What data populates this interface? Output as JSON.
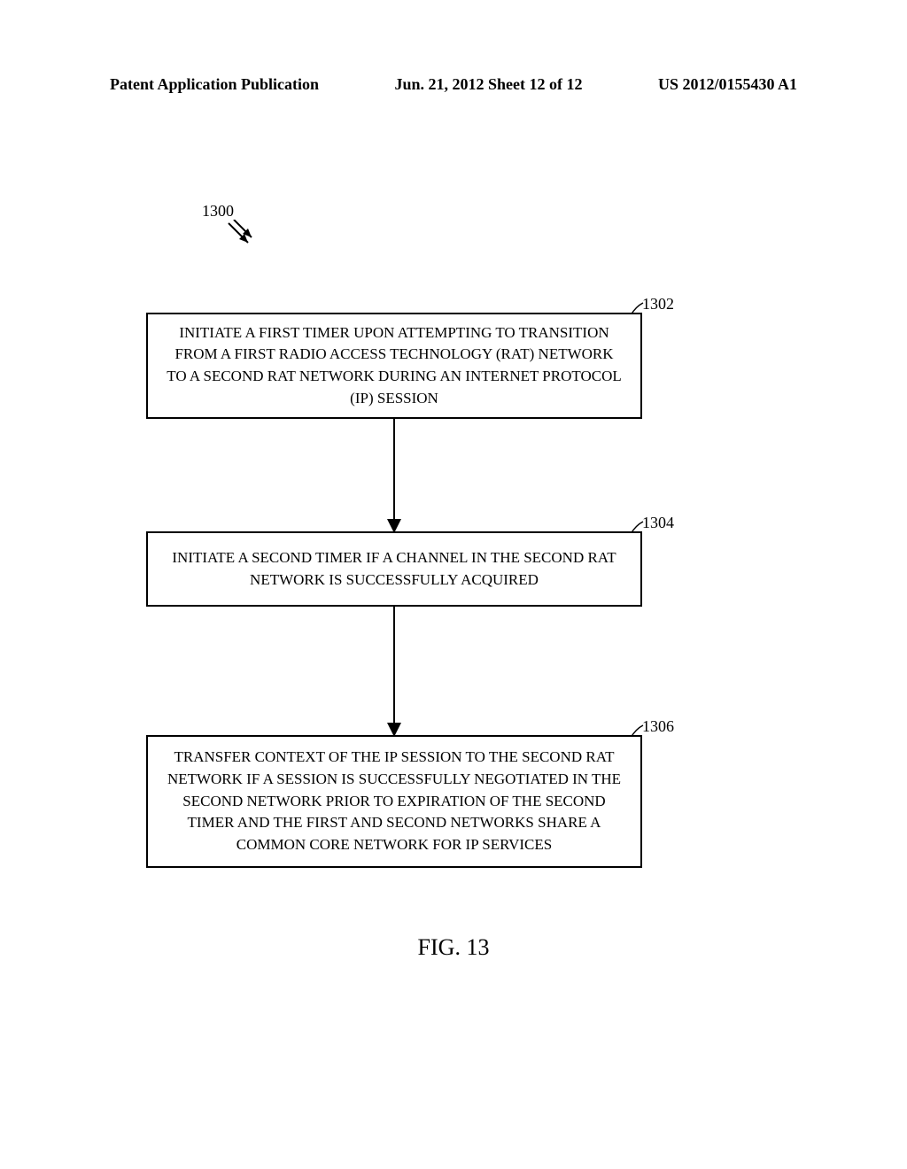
{
  "header": {
    "left": "Patent Application Publication",
    "center": "Jun. 21, 2012  Sheet 12 of 12",
    "right": "US 2012/0155430 A1"
  },
  "chart_data": {
    "type": "flowchart",
    "diagram_ref": "1300",
    "steps": [
      {
        "ref": "1302",
        "text": "INITIATE A FIRST TIMER UPON ATTEMPTING TO TRANSITION FROM A FIRST RADIO ACCESS TECHNOLOGY (RAT) NETWORK TO A SECOND RAT NETWORK DURING AN INTERNET PROTOCOL (IP) SESSION"
      },
      {
        "ref": "1304",
        "text": "INITIATE A SECOND TIMER IF A CHANNEL IN THE SECOND RAT NETWORK IS SUCCESSFULLY ACQUIRED"
      },
      {
        "ref": "1306",
        "text": "TRANSFER CONTEXT OF THE IP SESSION TO THE SECOND RAT NETWORK IF A SESSION IS SUCCESSFULLY NEGOTIATED IN THE SECOND NETWORK PRIOR TO EXPIRATION OF THE SECOND TIMER AND THE FIRST AND SECOND NETWORKS SHARE A COMMON CORE NETWORK FOR IP SERVICES"
      }
    ],
    "connections": [
      {
        "from": "1302",
        "to": "1304"
      },
      {
        "from": "1304",
        "to": "1306"
      }
    ]
  },
  "figure_label": "FIG. 13"
}
